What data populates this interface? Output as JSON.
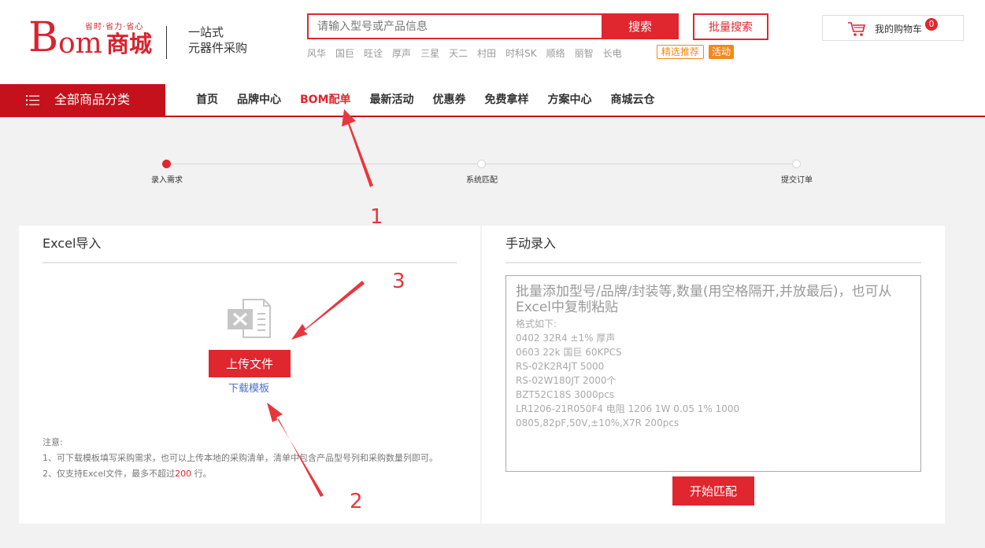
{
  "header": {
    "logo": {
      "b": "B",
      "om": "om",
      "cn": "商城",
      "slogan": "省时·省力·省心"
    },
    "tagline": [
      "一站式",
      "元器件采购"
    ],
    "search": {
      "placeholder": "请输入型号或产品信息",
      "button": "搜索"
    },
    "batch_search": "批量搜索",
    "hot_keywords": [
      "风华",
      "国巨",
      "旺诠",
      "厚声",
      "三星",
      "天二",
      "村田",
      "时科SK",
      "顺络",
      "丽智",
      "长电"
    ],
    "tag_featured": "精选推荐",
    "tag_activity": "活动",
    "cart": {
      "label": "我的购物车",
      "count": "0",
      "icon": "shopping-cart-icon"
    }
  },
  "nav": {
    "all_categories": "全部商品分类",
    "links": [
      {
        "label": "首页",
        "active": false
      },
      {
        "label": "品牌中心",
        "active": false
      },
      {
        "label": "BOM配单",
        "active": true
      },
      {
        "label": "最新活动",
        "active": false
      },
      {
        "label": "优惠券",
        "active": false
      },
      {
        "label": "免费拿样",
        "active": false
      },
      {
        "label": "方案中心",
        "active": false
      },
      {
        "label": "商城云仓",
        "active": false
      }
    ]
  },
  "stepper": {
    "steps": [
      {
        "label": "录入需求",
        "active": true
      },
      {
        "label": "系统匹配",
        "active": false
      },
      {
        "label": "提交订单",
        "active": false
      }
    ]
  },
  "excel_panel": {
    "title": "Excel导入",
    "upload_button": "上传文件",
    "download_link": "下载模板",
    "notes_title": "注意:",
    "note1": "1、可下载模板填写采购需求，也可以上传本地的采购清单，清单中包含产品型号列和采购数量列即可。",
    "note2_prefix": "2、仅支持Excel文件，最多不超过",
    "note2_highlight": "200",
    "note2_suffix": " 行。"
  },
  "manual_panel": {
    "title": "手动录入",
    "hint": "批量添加型号/品牌/封装等,数量(用空格隔开,并放最后)，也可从Excel中复制粘贴",
    "format_label": "格式如下:",
    "examples": [
      "0402 32R4 ±1% 厚声",
      "0603 22k 国巨 60KPCS",
      "RS-02K2R4JT 5000",
      "RS-02W180JT 2000个",
      "BZT52C18S 3000pcs",
      "LR1206-21R050F4 电阻 1206 1W 0.05 1% 1000",
      "0805,82pF,50V,±10%,X7R 200pcs"
    ],
    "match_button": "开始匹配"
  },
  "annotations": {
    "label1": "1",
    "label2": "2",
    "label3": "3"
  },
  "colors": {
    "brand_red": "#e0262f",
    "nav_red": "#c4111b",
    "orange": "#f08a1d",
    "link_blue": "#4b6ed6"
  }
}
